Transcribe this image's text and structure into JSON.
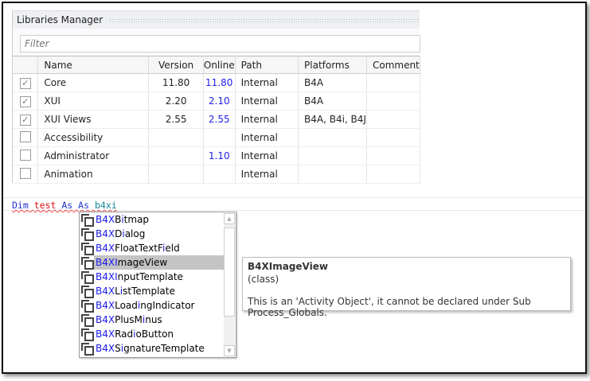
{
  "libraries_manager": {
    "title": "Libraries Manager",
    "filter_placeholder": "Filter",
    "columns": [
      "",
      "Name",
      "Version",
      "Online",
      "Path",
      "Platforms",
      "Comment"
    ],
    "rows": [
      {
        "checked": true,
        "name": "Core",
        "version": "11.80",
        "online": "11.80",
        "path": "Internal",
        "platforms": "B4A",
        "comment": ""
      },
      {
        "checked": true,
        "name": "XUI",
        "version": "2.20",
        "online": "2.10",
        "path": "Internal",
        "platforms": "B4A",
        "comment": ""
      },
      {
        "checked": true,
        "name": "XUI Views",
        "version": "2.55",
        "online": "2.55",
        "path": "Internal",
        "platforms": "B4A, B4i, B4J",
        "comment": ""
      },
      {
        "checked": false,
        "name": "Accessibility",
        "version": "",
        "online": "",
        "path": "Internal",
        "platforms": "",
        "comment": ""
      },
      {
        "checked": false,
        "name": "Administrator",
        "version": "",
        "online": "1.10",
        "path": "Internal",
        "platforms": "",
        "comment": ""
      },
      {
        "checked": false,
        "name": "Animation",
        "version": "",
        "online": "",
        "path": "Internal",
        "platforms": "",
        "comment": ""
      }
    ]
  },
  "code_line": {
    "kw1": "Dim",
    "ident": "test",
    "kw2": "As",
    "kw3": "As",
    "typed": "b4xi"
  },
  "autocomplete": {
    "selected_index": 3,
    "items": [
      {
        "segs": [
          "B4X",
          "B",
          "i",
          "tmap"
        ]
      },
      {
        "segs": [
          "B4X",
          "D",
          "i",
          "alog"
        ]
      },
      {
        "segs": [
          "B4X",
          "FloatTextF",
          "i",
          "eld"
        ]
      },
      {
        "segs": [
          "B4XI",
          "",
          "",
          "mageView"
        ]
      },
      {
        "segs": [
          "B4XI",
          "",
          "",
          "nputTemplate"
        ]
      },
      {
        "segs": [
          "B4X",
          "L",
          "i",
          "stTemplate"
        ]
      },
      {
        "segs": [
          "B4X",
          "Load",
          "i",
          "ngIndicator"
        ]
      },
      {
        "segs": [
          "B4X",
          "PlusM",
          "i",
          "nus"
        ]
      },
      {
        "segs": [
          "B4X",
          "Rad",
          "i",
          "oButton"
        ]
      },
      {
        "segs": [
          "B4X",
          "S",
          "i",
          "gnatureTemplate"
        ]
      }
    ]
  },
  "tooltip": {
    "title": "B4XImageView",
    "kind": "(class)",
    "description": "This is an 'Activity Object', it cannot be declared under Sub Process_Globals."
  }
}
